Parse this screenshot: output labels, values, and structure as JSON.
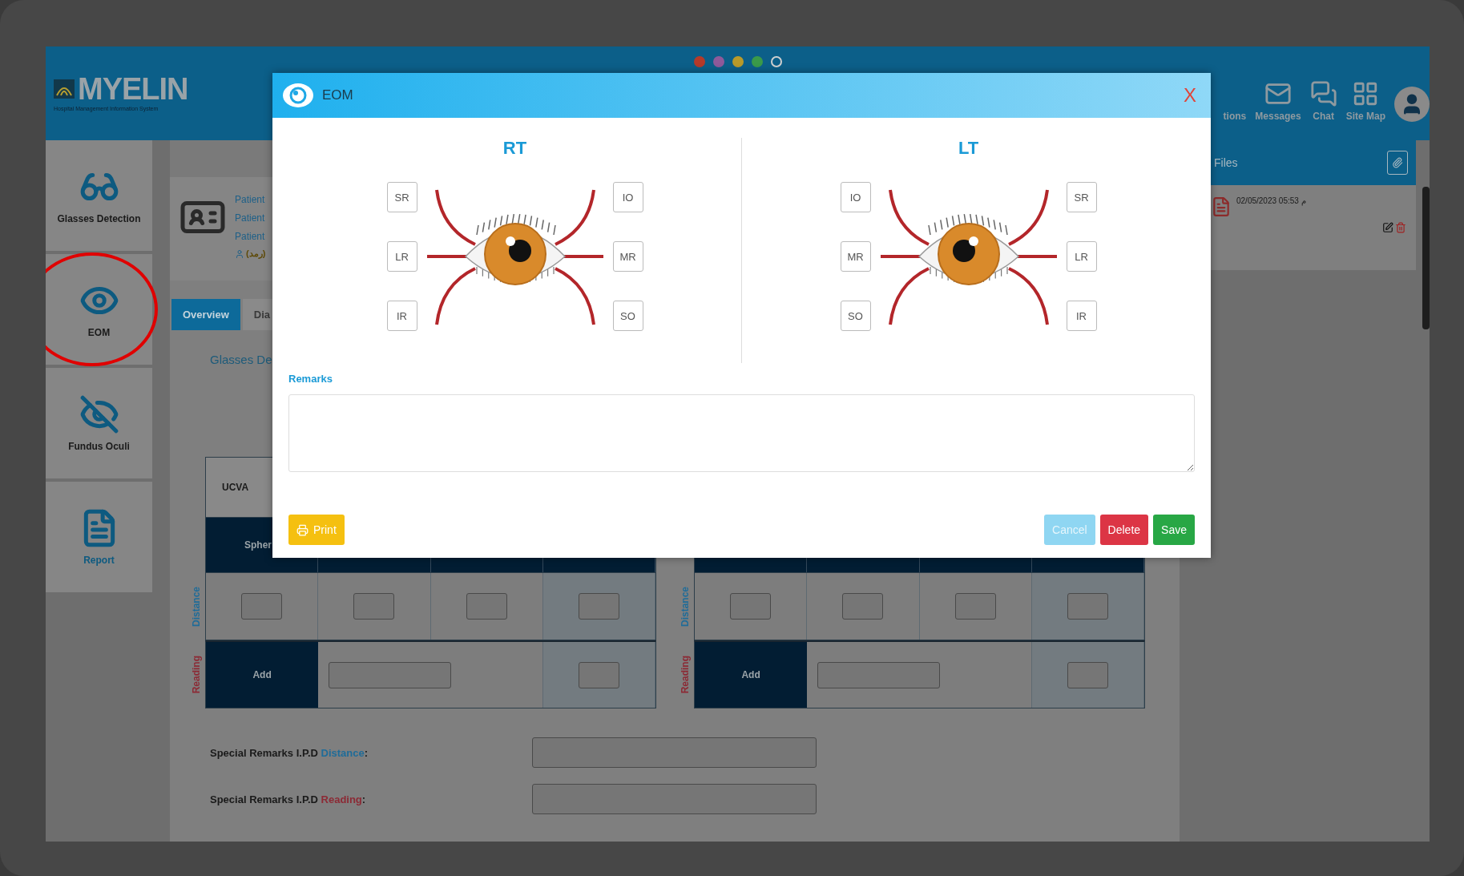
{
  "header": {
    "logo": {
      "name": "MYELIN",
      "tagline": "Hospital Management Information System"
    },
    "pager_dots": [
      {
        "color": "#b53a2a",
        "filled": true
      },
      {
        "color": "#8e5a9a",
        "filled": true
      },
      {
        "color": "#b89a2a",
        "filled": true
      },
      {
        "color": "#3a9a4a",
        "filled": true
      },
      {
        "color": "#d0d0d0",
        "filled": false
      }
    ],
    "nav": [
      {
        "label": "tions",
        "kind": "text"
      },
      {
        "label": "Messages",
        "kind": "mail"
      },
      {
        "label": "Chat",
        "kind": "chat"
      },
      {
        "label": "Site Map",
        "kind": "grid"
      }
    ]
  },
  "sidebar": {
    "items": [
      {
        "label": "Glasses Detection",
        "kind": "glasses",
        "circled": false
      },
      {
        "label": "EOM",
        "kind": "eye",
        "circled": true
      },
      {
        "label": "Fundus Oculi",
        "kind": "eye_off",
        "circled": false
      },
      {
        "label": "Report",
        "kind": "report",
        "circled": false
      }
    ]
  },
  "patient": {
    "lines": [
      "Patient",
      "Patient",
      "Patient"
    ],
    "department": "(رمد)"
  },
  "tabs": [
    {
      "label": "Overview",
      "selected": true
    },
    {
      "label": "Dia",
      "selected": false
    }
  ],
  "section": {
    "legend": "Glasses De",
    "tables": [
      {
        "ucva_label": "UCVA",
        "header": [
          "Spher"
        ],
        "distance_label": "Distance",
        "reading_label": "Reading",
        "add_label": "Add"
      },
      {
        "distance_label": "Distance",
        "reading_label": "Reading",
        "add_label": "Add"
      }
    ],
    "special_remarks": [
      {
        "text": "Special Remarks I.P.D",
        "word": "Distance",
        "suffix": ":",
        "kind": "distance"
      },
      {
        "text": "Special Remarks I.P.D",
        "word": "Reading",
        "suffix": ":",
        "kind": "reading"
      }
    ]
  },
  "files": {
    "title": "Files",
    "entries": [
      {
        "date": "02/05/2023 05:53 م"
      }
    ]
  },
  "modal": {
    "title": "EOM",
    "close": "X",
    "eyes": [
      {
        "title": "RT",
        "mirrored": false,
        "left": [
          "SR",
          "LR",
          "IR"
        ],
        "right": [
          "IO",
          "MR",
          "SO"
        ]
      },
      {
        "title": "LT",
        "mirrored": true,
        "left": [
          "IO",
          "MR",
          "SO"
        ],
        "right": [
          "SR",
          "LR",
          "IR"
        ]
      }
    ],
    "remarks_label": "Remarks",
    "buttons": [
      {
        "label": "Print",
        "kind": "print"
      },
      {
        "label": "Cancel",
        "kind": "cancel"
      },
      {
        "label": "Delete",
        "kind": "delete"
      },
      {
        "label": "Save",
        "kind": "save"
      }
    ]
  }
}
